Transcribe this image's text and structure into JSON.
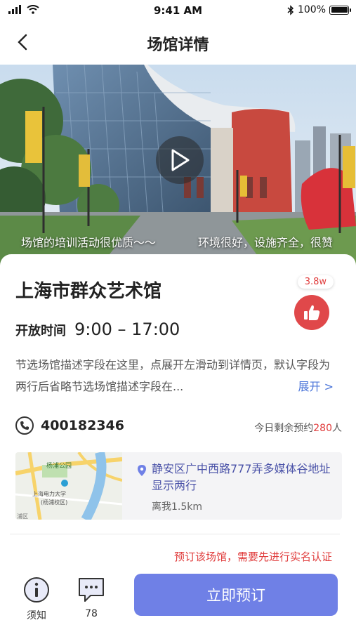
{
  "status_bar": {
    "time": "9:41 AM",
    "battery": "100%"
  },
  "nav": {
    "title": "场馆详情",
    "back_icon": "chevron-left-icon"
  },
  "hero": {
    "play_icon": "play-icon",
    "danmaku": [
      "场馆的培训活动很优质～～",
      "环境很好，设施齐全，很赞"
    ]
  },
  "venue": {
    "name": "上海市群众艺术馆",
    "like_count": "3.8w",
    "like_icon": "thumbs-up-icon",
    "open_label": "开放时间",
    "open_time": "9:00 – 17:00",
    "description": "节选场馆描述字段在这里，点展开左滑动到详情页，默认字段为两行后省略节选场馆描述字段在...",
    "expand_label": "展开 >",
    "phone": "400182346",
    "remain_prefix": "今日剩余预约",
    "remain_count": "280",
    "remain_suffix": "人"
  },
  "address": {
    "text": "静安区广中西路777弄多媒体谷地址显示两行",
    "distance": "离我1.5km",
    "map_labels": {
      "park": "杨浦公园",
      "university": "上海电力大学",
      "campus": "(杨浦校区)",
      "district": "浦区"
    }
  },
  "notice": "预订该场馆，需要先进行实名认证",
  "bottom": {
    "notice_label": "须知",
    "comment_count": "78",
    "book_label": "立即预订"
  },
  "colors": {
    "accent": "#6f80e6",
    "red": "#e03c3c",
    "link": "#4a74d9",
    "address": "#4a52a8"
  }
}
